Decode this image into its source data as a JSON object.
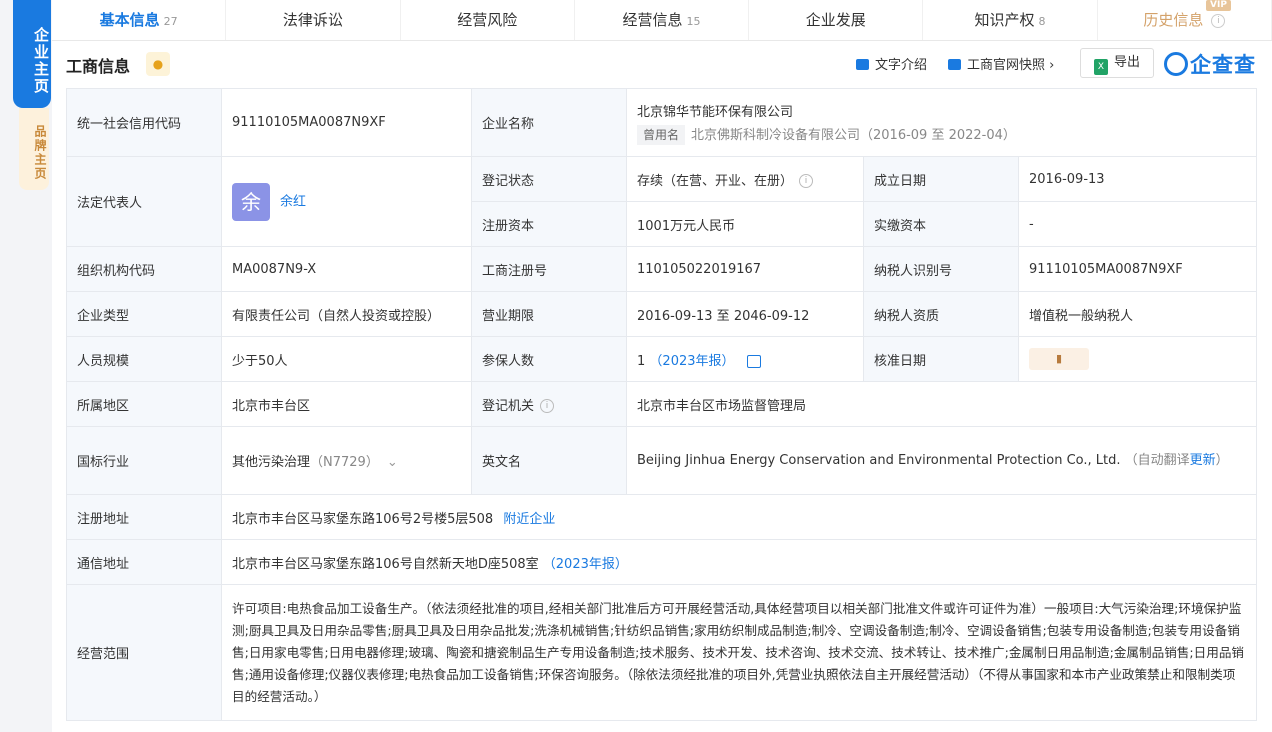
{
  "sidebar": {
    "main": "企业主页",
    "brand": "品牌主页"
  },
  "tabs": [
    {
      "label": "基本信息",
      "count": "27"
    },
    {
      "label": "法律诉讼",
      "count": ""
    },
    {
      "label": "经营风险",
      "count": ""
    },
    {
      "label": "经营信息",
      "count": "15"
    },
    {
      "label": "企业发展",
      "count": ""
    },
    {
      "label": "知识产权",
      "count": "8"
    },
    {
      "label": "历史信息",
      "count": "",
      "badge": "VIP"
    }
  ],
  "header": {
    "title": "工商信息",
    "text_intro": "文字介绍",
    "snapshot": "工商官网快照",
    "export": "导出",
    "logo": "企查查"
  },
  "rows": {
    "credit_code_label": "统一社会信用代码",
    "credit_code": "91110105MA0087N9XF",
    "company_name_label": "企业名称",
    "company_name": "北京锦华节能环保有限公司",
    "former_tag": "曾用名",
    "former_name": "北京佛斯科制冷设备有限公司（2016-09 至 2022-04）",
    "legal_rep_label": "法定代表人",
    "legal_rep_avatar": "余",
    "legal_rep": "余红",
    "status_label": "登记状态",
    "status": "存续（在营、开业、在册）",
    "founded_label": "成立日期",
    "founded": "2016-09-13",
    "reg_capital_label": "注册资本",
    "reg_capital": "1001万元人民币",
    "paid_capital_label": "实缴资本",
    "paid_capital": "-",
    "org_code_label": "组织机构代码",
    "org_code": "MA0087N9-X",
    "reg_no_label": "工商注册号",
    "reg_no": "110105022019167",
    "tax_id_label": "纳税人识别号",
    "tax_id": "91110105MA0087N9XF",
    "type_label": "企业类型",
    "type": "有限责任公司（自然人投资或控股）",
    "term_label": "营业期限",
    "term": "2016-09-13 至 2046-09-12",
    "taxpayer_label": "纳税人资质",
    "taxpayer": "增值税一般纳税人",
    "staff_label": "人员规模",
    "staff": "少于50人",
    "insured_label": "参保人数",
    "insured": "1",
    "insured_year": "（2023年报）",
    "approve_label": "核准日期",
    "region_label": "所属地区",
    "region": "北京市丰台区",
    "authority_label": "登记机关",
    "authority": "北京市丰台区市场监督管理局",
    "industry_label": "国标行业",
    "industry": "其他污染治理",
    "industry_code": "（N7729）",
    "en_name_label": "英文名",
    "en_name": "Beijing Jinhua Energy Conservation and Environmental Protection Co., Ltd.",
    "auto_trans": "（自动翻译",
    "update": "更新",
    "close_paren": "）",
    "address_label": "注册地址",
    "address": "北京市丰台区马家堡东路106号2号楼5层508",
    "nearby": "附近企业",
    "mail_label": "通信地址",
    "mail": "北京市丰台区马家堡东路106号自然新天地D座508室",
    "mail_year": "（2023年报）",
    "scope_label": "经营范围",
    "scope": "许可项目:电热食品加工设备生产。（依法须经批准的项目,经相关部门批准后方可开展经营活动,具体经营项目以相关部门批准文件或许可证件为准）一般项目:大气污染治理;环境保护监测;厨具卫具及日用杂品零售;厨具卫具及日用杂品批发;洗涤机械销售;针纺织品销售;家用纺织制成品制造;制冷、空调设备制造;制冷、空调设备销售;包装专用设备制造;包装专用设备销售;日用家电零售;日用电器修理;玻璃、陶瓷和搪瓷制品生产专用设备制造;技术服务、技术开发、技术咨询、技术交流、技术转让、技术推广;金属制日用品制造;金属制品销售;日用品销售;通用设备修理;仪器仪表修理;电热食品加工设备销售;环保咨询服务。（除依法须经批准的项目外,凭营业执照依法自主开展经营活动）（不得从事国家和本市产业政策禁止和限制类项目的经营活动。）"
  }
}
